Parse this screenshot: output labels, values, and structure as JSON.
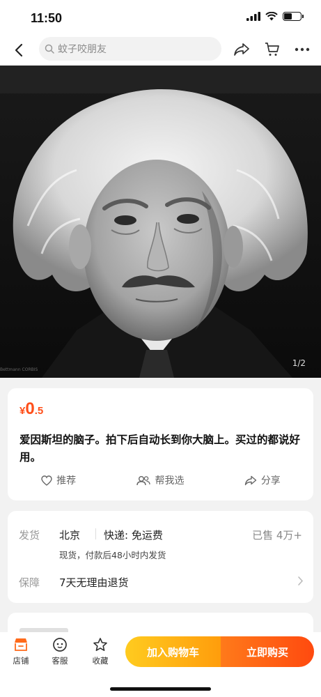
{
  "status": {
    "time": "11:50",
    "battery_level": 0.5,
    "icons": [
      "signal-icon",
      "wifi-icon",
      "battery-icon"
    ]
  },
  "nav": {
    "back_icon": "chevron-left-icon",
    "search_placeholder": "蚊子咬朋友",
    "icons": [
      "share-icon",
      "cart-icon",
      "more-icon"
    ]
  },
  "hero": {
    "page_indicator": "1/2",
    "watermark": "Bettmann CORBIS"
  },
  "product": {
    "currency": "¥",
    "price_int": "0",
    "price_dec": ".5",
    "title": "爱因斯坦的脑子。拍下后自动长到你大脑上。买过的都说好用。",
    "actions": [
      {
        "label": "推荐",
        "icon": "heart-icon"
      },
      {
        "label": "帮我选",
        "icon": "people-icon"
      },
      {
        "label": "分享",
        "icon": "share-icon"
      }
    ]
  },
  "shipping": {
    "label": "发货",
    "city": "北京",
    "express": "快递: 免运费",
    "sold": "已售  4万+",
    "detail": "现货，付款后48小时内发货",
    "guarantee_label": "保障",
    "guarantee": "7天无理由退货"
  },
  "bottom": {
    "tabs": [
      {
        "label": "店铺",
        "icon": "store-icon"
      },
      {
        "label": "客服",
        "icon": "chat-icon"
      },
      {
        "label": "收藏",
        "icon": "star-icon"
      }
    ],
    "add_to_cart": "加入购物车",
    "buy_now": "立即购买"
  },
  "colors": {
    "accent": "#ff4f1a",
    "cart_button": "#ffb414",
    "buy_button": "#ff5a12"
  }
}
